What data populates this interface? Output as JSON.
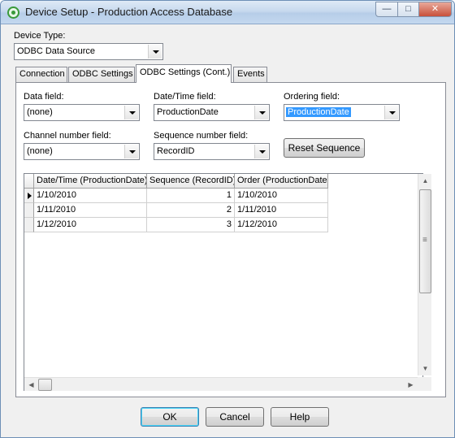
{
  "window": {
    "title": "Device Setup - Production Access Database",
    "min_glyph": "—",
    "max_glyph": "□",
    "close_glyph": "✕"
  },
  "device_type": {
    "label": "Device Type:",
    "value": "ODBC Data Source"
  },
  "tabs": [
    {
      "label": "Connection"
    },
    {
      "label": "ODBC Settings"
    },
    {
      "label": "ODBC Settings (Cont.)"
    },
    {
      "label": "Events"
    }
  ],
  "active_tab": "ODBC Settings (Cont.)",
  "fields": {
    "data_field": {
      "label": "Data field:",
      "value": "(none)"
    },
    "datetime_field": {
      "label": "Date/Time field:",
      "value": "ProductionDate"
    },
    "ordering_field": {
      "label": "Ordering field:",
      "value": "ProductionDate"
    },
    "channel_field": {
      "label": "Channel number field:",
      "value": "(none)"
    },
    "sequence_field": {
      "label": "Sequence number field:",
      "value": "RecordID"
    }
  },
  "reset_sequence_label": "Reset Sequence",
  "grid": {
    "columns": [
      "Date/Time (ProductionDate)",
      "Sequence (RecordID)",
      "Order (ProductionDate)"
    ],
    "rows": [
      [
        "1/10/2010",
        "1",
        "1/10/2010"
      ],
      [
        "1/11/2010",
        "2",
        "1/11/2010"
      ],
      [
        "1/12/2010",
        "3",
        "1/12/2010"
      ]
    ]
  },
  "buttons": {
    "ok": "OK",
    "cancel": "Cancel",
    "help": "Help"
  },
  "colors": {
    "selection": "#3399ff",
    "title_gradient": "#c7d9ee"
  }
}
